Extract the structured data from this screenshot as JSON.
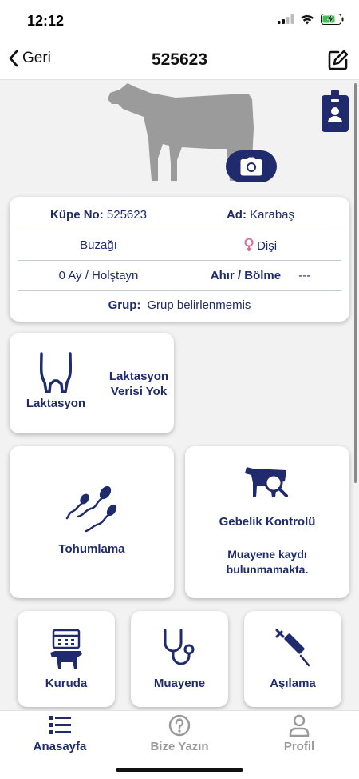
{
  "status": {
    "time": "12:12"
  },
  "nav": {
    "back_label": "Geri",
    "title": "525623"
  },
  "info": {
    "kupe_label": "Küpe No:",
    "kupe_value": "525623",
    "ad_label": "Ad:",
    "ad_value": "Karabaş",
    "category": "Buzağı",
    "gender": "Dişi",
    "age_breed": "0 Ay / Holştayn",
    "barn_label": "Ahır / Bölme",
    "barn_value": "---",
    "group_label": "Grup:",
    "group_value": "Grup belirlenmemis"
  },
  "tiles": {
    "lactation": {
      "label": "Laktasyon",
      "status": "Laktasyon Verisi Yok"
    },
    "insemination": {
      "label": "Tohumlama"
    },
    "pregnancy": {
      "label": "Gebelik Kontrolü",
      "status": "Muayene kaydı bulunmamakta."
    },
    "dry": {
      "label": "Kuruda"
    },
    "exam": {
      "label": "Muayene"
    },
    "vaccine": {
      "label": "Aşılama"
    }
  },
  "tabbar": {
    "home": "Anasayfa",
    "contact": "Bize Yazın",
    "profile": "Profil"
  },
  "colors": {
    "primary": "#1f2b6c",
    "gender_female": "#e06a9a",
    "inactive": "#9a9a9a"
  }
}
